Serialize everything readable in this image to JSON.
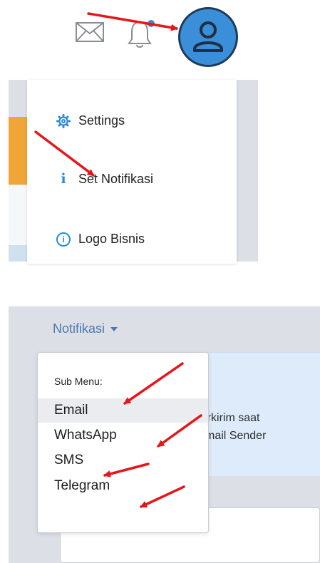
{
  "profile_menu": {
    "items": [
      {
        "label": "Settings",
        "icon": "gear-icon"
      },
      {
        "label": "Set Notifikasi",
        "icon": "info-icon"
      },
      {
        "label": "Logo Bisnis",
        "icon": "info-circle-icon"
      }
    ]
  },
  "notifikasi": {
    "toggle_label": "Notifikasi",
    "sub_header": "Sub Menu:",
    "items": [
      "Email",
      "WhatsApp",
      "SMS",
      "Telegram"
    ],
    "active_item": "Email"
  },
  "info_text": {
    "line1": "n terkirim saat",
    "line2": "n Email Sender"
  },
  "colors": {
    "accent_blue": "#3b8ed8",
    "link_blue": "#4b78ad",
    "arrow_red": "#e5161b",
    "orange": "#f0a637"
  }
}
